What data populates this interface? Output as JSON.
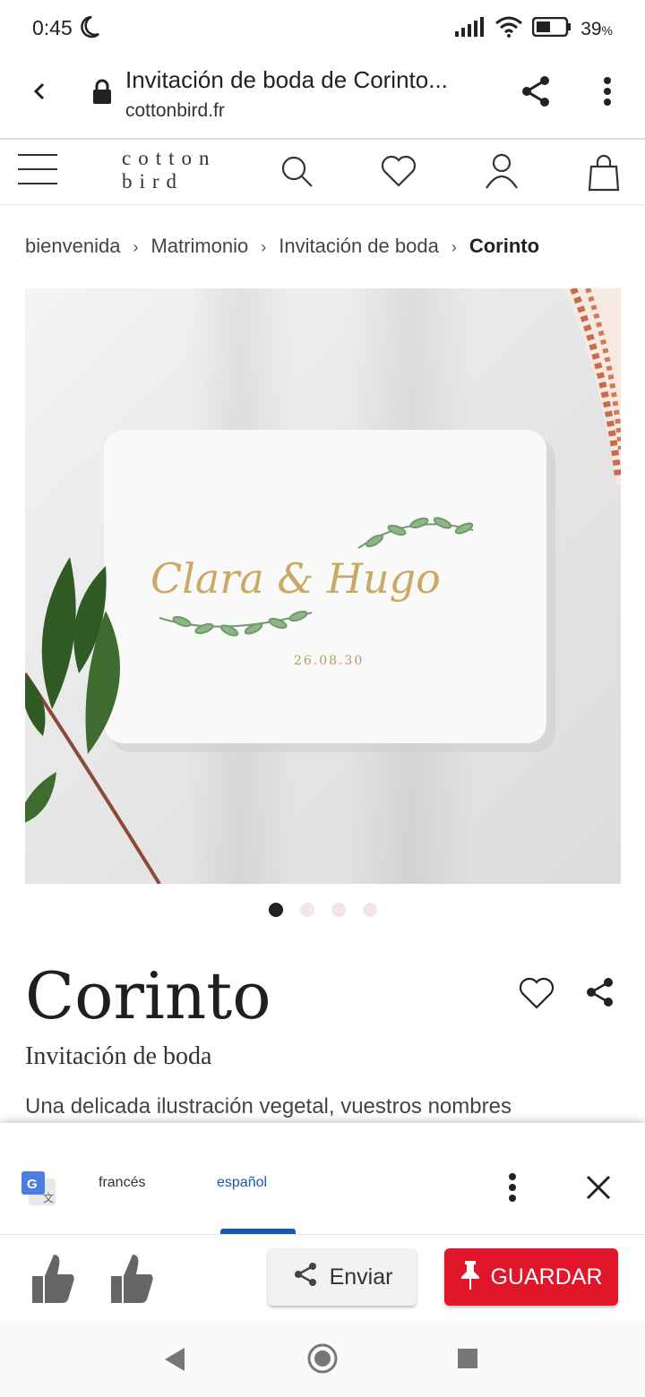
{
  "status": {
    "time": "0:45",
    "battery": "39"
  },
  "browser": {
    "title": "Invitación de boda de Corinto...",
    "domain": "cottonbird.fr"
  },
  "site": {
    "logo_line1": "cotton",
    "logo_line2": "bird"
  },
  "breadcrumb": {
    "items": [
      "bienvenida",
      "Matrimonio",
      "Invitación de boda"
    ],
    "current": "Corinto",
    "separator": "›"
  },
  "hero": {
    "card_names": "Clara & Hugo",
    "card_date": "26.08.30"
  },
  "carousel": {
    "count": 4,
    "active": 0
  },
  "product": {
    "title": "Corinto",
    "subtitle": "Invitación de boda",
    "description": "Una delicada ilustración vegetal, vuestros nombres"
  },
  "translate": {
    "source_lang": "francés",
    "target_lang": "español"
  },
  "actions": {
    "send_label": "Enviar",
    "save_label": "GUARDAR"
  },
  "colors": {
    "accent_translate": "#1a57b3",
    "save_button": "#e0162b"
  }
}
